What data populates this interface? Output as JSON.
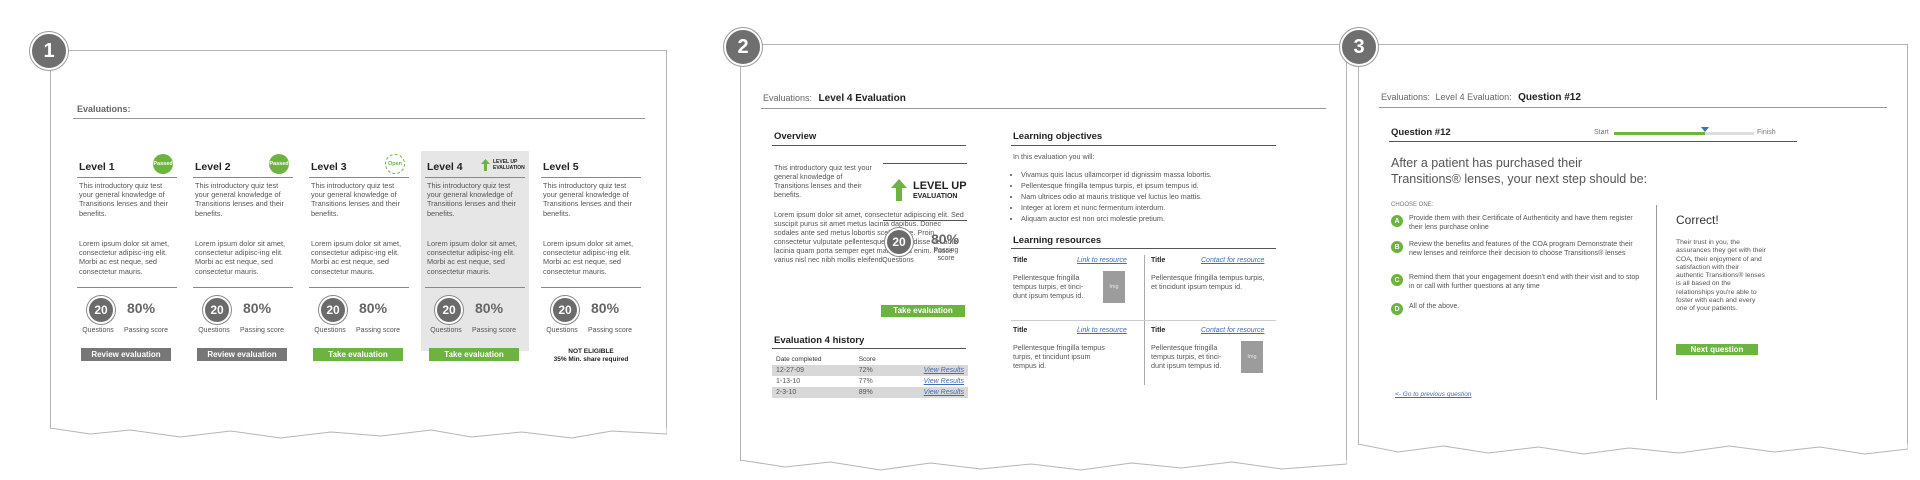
{
  "panel1": {
    "step": "1",
    "header_label": "Evaluations:",
    "levels": [
      {
        "title": "Level 1",
        "sticker": "Passed",
        "desc": "This introductory quiz test your general knowledge of Transitions lenses and their benefits.",
        "desc2": "Lorem ipsum dolor sit amet, consectetur adipisc-ing elit. Morbi ac est neque, sed consectetur mauris.",
        "questions": "20",
        "passing": "80%",
        "q_label": "Questions",
        "p_label": "Passing score",
        "action": "Review evaluation"
      },
      {
        "title": "Level 2",
        "sticker": "Passed",
        "desc": "This introductory quiz test your general knowledge of Transitions lenses and their benefits.",
        "desc2": "Lorem ipsum dolor sit amet, consectetur adipisc-ing elit. Morbi ac est neque, sed consectetur mauris.",
        "questions": "20",
        "passing": "80%",
        "q_label": "Questions",
        "p_label": "Passing score",
        "action": "Review evaluation"
      },
      {
        "title": "Level 3",
        "sticker": "Open",
        "desc": "This introductory quiz test your general knowledge of Transitions lenses and their benefits.",
        "desc2": "Lorem ipsum dolor sit amet, consectetur adipisc-ing elit. Morbi ac est neque, sed consectetur mauris.",
        "questions": "20",
        "passing": "80%",
        "q_label": "Questions",
        "p_label": "Passing score",
        "action": "Take evaluation"
      },
      {
        "title": "Level 4",
        "sticker": "LEVEL UP EVALUATION",
        "desc": "This introductory quiz test your general knowledge of Transitions lenses and their benefits.",
        "desc2": "Lorem ipsum dolor sit amet, consectetur adipisc-ing elit. Morbi ac est neque, sed consectetur mauris.",
        "questions": "20",
        "passing": "80%",
        "q_label": "Questions",
        "p_label": "Passing score",
        "action": "Take evaluation"
      },
      {
        "title": "Level 5",
        "sticker": "",
        "desc": "This introductory quiz test your general knowledge of Transitions lenses and their benefits.",
        "desc2": "Lorem ipsum dolor sit amet, consectetur adipisc-ing elit. Morbi ac est neque, sed consectetur mauris.",
        "questions": "20",
        "passing": "80%",
        "q_label": "Questions",
        "p_label": "Passing score",
        "not_eligible": "NOT ELIGIBLE",
        "min_share": "35% Min. share required"
      }
    ]
  },
  "panel2": {
    "step": "2",
    "header_label": "Evaluations:",
    "header_title": "Level 4 Evaluation",
    "overview_title": "Overview",
    "overview_desc": "This introductory quiz test your general knowledge of Transitions lenses and their benefits.",
    "overview_body": "Lorem ipsum dolor sit amet, consectetur adipiscing elit. Sed suscipit purus sit amet metus lacinia dapibus. Donec sodales ante sed metus lobortis scelerisque. Proin consectetur vulputate pellentesque. Suspendisse vel ante lacinia quam porta semper eget malesuada enim. Fusce varius nisl nec nibh mollis eleifend.",
    "levelup_line1": "LEVEL UP",
    "levelup_line2": "EVALUATION",
    "questions": "20",
    "passing": "80%",
    "q_label": "Questions",
    "p_label": "Passing score",
    "take_button": "Take evaluation",
    "history_title": "Evaluation 4 history",
    "history_headers": [
      "Date completed",
      "Score"
    ],
    "history": [
      {
        "date": "12-27-09",
        "score": "72%",
        "link": "View Results"
      },
      {
        "date": "1-13-10",
        "score": "77%",
        "link": "View Results"
      },
      {
        "date": "2-3-10",
        "score": "89%",
        "link": "View Results"
      }
    ],
    "objectives_title": "Learning objectives",
    "objectives_intro": "In this evaluation you will:",
    "objectives": [
      "Vivamus quis lacus ullamcorper id dignissim massa lobortis.",
      "Pellentesque fringilla tempus turpis, et ipsum tempus id.",
      "Nam ultrices odio at mauris tristique vel luctus leo mattis.",
      "Integer at lorem et nunc fermentum interdum.",
      "Aliquam auctor est non orci molestie pretium."
    ],
    "resources_title": "Learning resources",
    "resources": [
      {
        "title": "Title",
        "link": "Link to resource",
        "body": "Pellentesque fringilla tempus turpis, et tinci-dunt ipsum tempus id.",
        "img": "Img"
      },
      {
        "title": "Title",
        "link": "Contact for resource",
        "body": "Pellentesque fringilla tempus turpis, et tincidunt ipsum tempus id.",
        "img": ""
      },
      {
        "title": "Title",
        "link": "Link to resource",
        "body": "Pellentesque fringilla tempus turpis, et tincidunt ipsum tempus id.",
        "img": ""
      },
      {
        "title": "Title",
        "link": "Contact for resource",
        "body": "Pellentesque fringilla tempus turpis, et tinci-dunt ipsum tempus id.",
        "img": "Img"
      }
    ]
  },
  "panel3": {
    "step": "3",
    "crumb1": "Evaluations:",
    "crumb2": "Level 4 Evaluation:",
    "crumb3": "Question #12",
    "question_label": "Question #12",
    "progress_start": "Start",
    "progress_finish": "Finish",
    "progress": 0.65,
    "question": "After a patient has purchased their Transitions® lenses, your next step should be:",
    "choose": "CHOOSE ONE:",
    "answers": [
      {
        "key": "A",
        "text": "Provide them with their Certificate of Authenticity and have them register their lens purchase online"
      },
      {
        "key": "B",
        "text": "Review the benefits and features of the COA program Demonstrate their new lenses and reinforce their decision to choose Transitions® lenses"
      },
      {
        "key": "C",
        "text": "Remind them that your engagement doesn't end with their visit and to stop in or call with further questions at any time"
      },
      {
        "key": "D",
        "text": "All of the above."
      }
    ],
    "feedback_title": "Correct!",
    "feedback_body": "Their trust in you, the assurances they get with their COA, their enjoyment of and satisfaction with their authentic Transitions® lenses is all based on the relationships you're able to foster with each and every one of your patients.",
    "next_button": "Next question",
    "prev_link": "<- Go to previous question"
  },
  "colors": {
    "accent": "#6cb33f",
    "badge": "#6f6f6f",
    "link": "#3b6fb6"
  }
}
